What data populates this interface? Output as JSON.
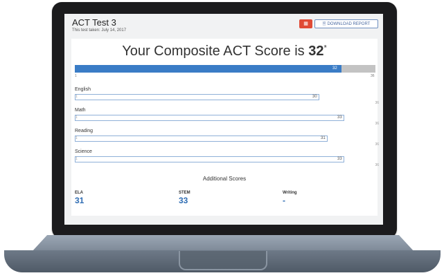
{
  "test": {
    "title": "ACT Test 3",
    "date": "This test taken: July 14, 2017"
  },
  "toolbar": {
    "chart_icon": "bar-chart-icon",
    "download_icon": "document-icon",
    "download_label": "DOWNLOAD REPORT"
  },
  "composite": {
    "prefix": "Your Composite ACT Score is ",
    "score": "32",
    "asterisk": "*",
    "bar_value": "32",
    "fraction": 0.886,
    "min_label": "1",
    "max_label": "36"
  },
  "subjects": [
    {
      "name": "English",
      "score": "30",
      "fraction": 0.829,
      "min": "1",
      "max": "36"
    },
    {
      "name": "Math",
      "score": "33",
      "fraction": 0.914,
      "min": "1",
      "max": "36"
    },
    {
      "name": "Reading",
      "score": "31",
      "fraction": 0.857,
      "min": "1",
      "max": "36"
    },
    {
      "name": "Science",
      "score": "33",
      "fraction": 0.914,
      "min": "1",
      "max": "36"
    }
  ],
  "additional": {
    "title": "Additional Scores",
    "items": [
      {
        "label": "ELA",
        "value": "31"
      },
      {
        "label": "STEM",
        "value": "33"
      },
      {
        "label": "Writing",
        "value": "-"
      }
    ]
  },
  "colors": {
    "composite_bar": "#3a7cc6",
    "composite_track": "#c3c3c3",
    "subject_border": "#8fb0d8",
    "accent_red": "#e04b36",
    "score_blue": "#2f6db3"
  }
}
